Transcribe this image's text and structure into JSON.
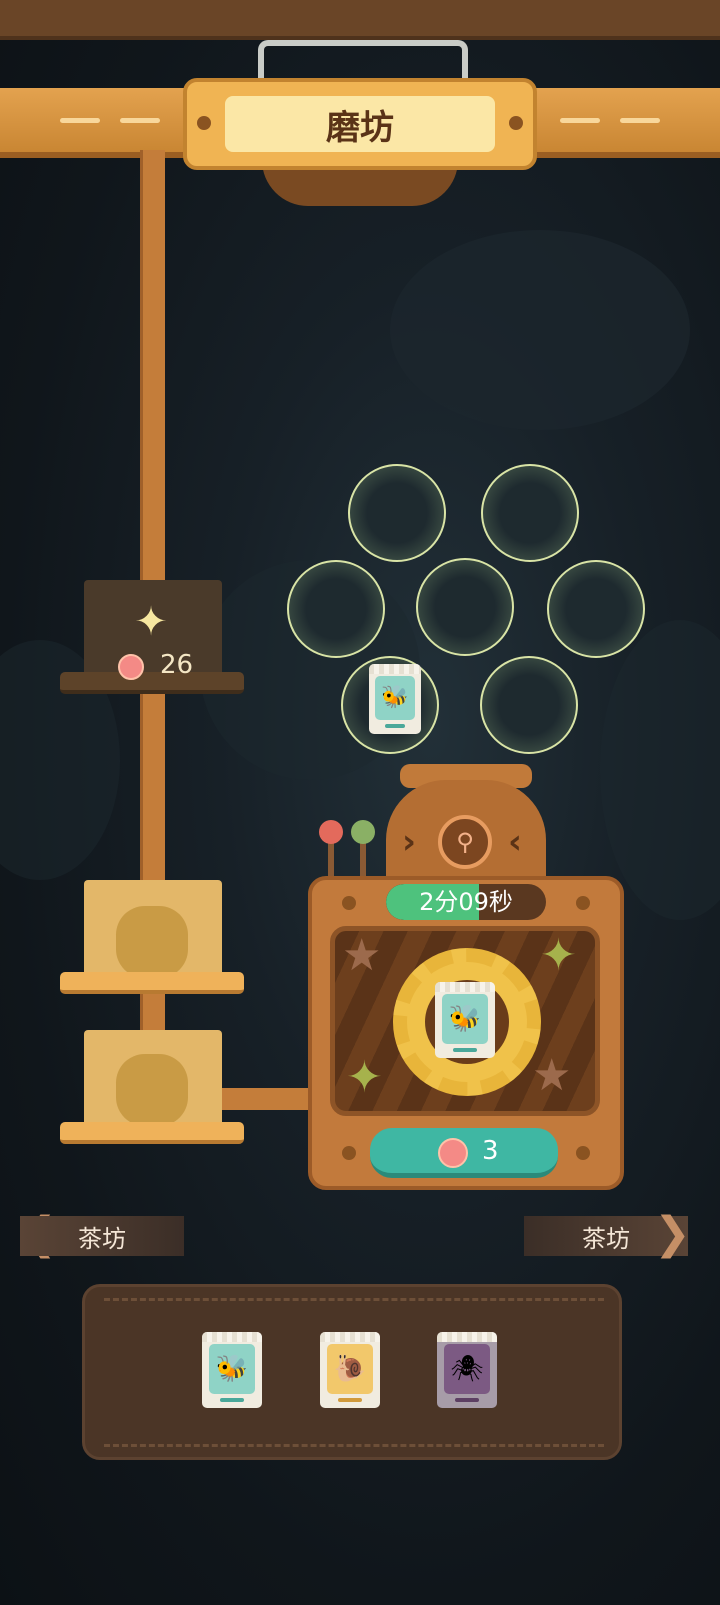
{
  "header": {
    "title": "磨坊"
  },
  "conveyor": {
    "locked_bin": {
      "cost": "26",
      "icons": [
        "sparkle-icon",
        "flower-coin-icon"
      ]
    }
  },
  "bubbles": {
    "slots": 7,
    "filled_slot": 6,
    "filled_item": "bee-seed-packet"
  },
  "machine": {
    "timer": "2分09秒",
    "timer_progress": 0.58,
    "processing_item": "bee-seed-packet",
    "cost": "3",
    "cost_icon": "flower-coin-icon"
  },
  "navigation": {
    "left_tab": "茶坊",
    "right_tab": "茶坊"
  },
  "tray": {
    "items": [
      {
        "name": "bee-seed-packet",
        "color": "#8fd3c6"
      },
      {
        "name": "snail-seed-packet",
        "color": "#f2c86b"
      },
      {
        "name": "spider-seed-packet",
        "color": "#9a6aa0"
      }
    ]
  },
  "colors": {
    "accent": "#f0b453",
    "teal": "#3fb7a3",
    "timer_green": "#4ec27d",
    "coin_pink": "#f48a86"
  }
}
